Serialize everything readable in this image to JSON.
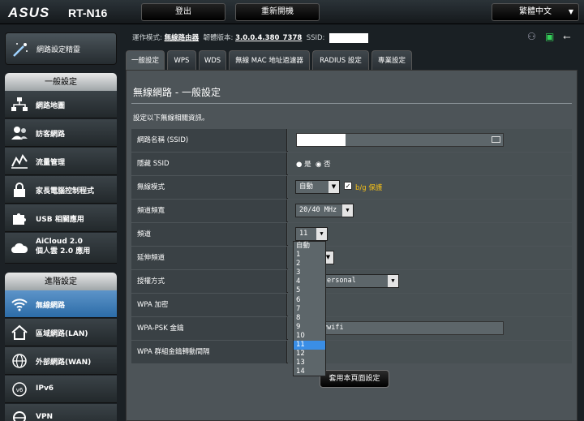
{
  "header": {
    "brand": "ASUS",
    "model": "RT-N16",
    "logout": "登出",
    "reboot": "重新開機",
    "language": "繁體中文"
  },
  "sidebar": {
    "quick_setup": "網路設定精靈",
    "general_title": "一般設定",
    "general_items": [
      "網路地圖",
      "訪客網路",
      "流量管理",
      "家長電腦控制程式",
      "USB 相關應用"
    ],
    "aicloud_line1": "AiCloud 2.0",
    "aicloud_line2": "個人雲 2.0 應用",
    "advanced_title": "進階設定",
    "advanced_items": [
      "無線網路",
      "區域網路(LAN)",
      "外部網路(WAN)",
      "IPv6",
      "VPN"
    ]
  },
  "info": {
    "mode_label": "運作模式:",
    "mode_value": "無線路由器",
    "fw_label": "韌體版本:",
    "fw_value": "3.0.0.4.380_7378",
    "ssid_label": "SSID:"
  },
  "tabs": [
    "一般設定",
    "WPS",
    "WDS",
    "無線 MAC 地址過濾器",
    "RADIUS 設定",
    "專業設定"
  ],
  "page": {
    "title": "無線網路 - 一般設定",
    "subtitle": "設定以下無線相關資訊。"
  },
  "form": {
    "ssid_label": "網路名稱 (SSID)",
    "hide_ssid_label": "隱藏 SSID",
    "hide_yes": "是",
    "hide_no": "否",
    "mode_label": "無線模式",
    "mode_value": "自動",
    "bg_protect": "b/g 保護",
    "bandwidth_label": "頻道頻寬",
    "bandwidth_value": "20/40 MHz",
    "channel_label": "頻道",
    "channel_value": "11",
    "ext_channel_label": "延伸頻道",
    "auth_label": "授權方式",
    "auth_fragment": "ersonal",
    "wpa_enc_label": "WPA 加密",
    "psk_label": "WPA-PSK 金鑰",
    "psk_fragment": "ywifi",
    "rekey_label": "WPA 群組金鑰轉動間隔",
    "apply": "套用本頁面設定"
  },
  "channel_options": [
    "自動",
    "1",
    "2",
    "3",
    "4",
    "5",
    "6",
    "7",
    "8",
    "9",
    "10",
    "11",
    "12",
    "13",
    "14"
  ],
  "channel_selected_index": 11,
  "colors": {
    "accent_blue": "#3a8ee6",
    "bg_protect_yellow": "#f5c018",
    "active_menu": "#4a86bd"
  }
}
